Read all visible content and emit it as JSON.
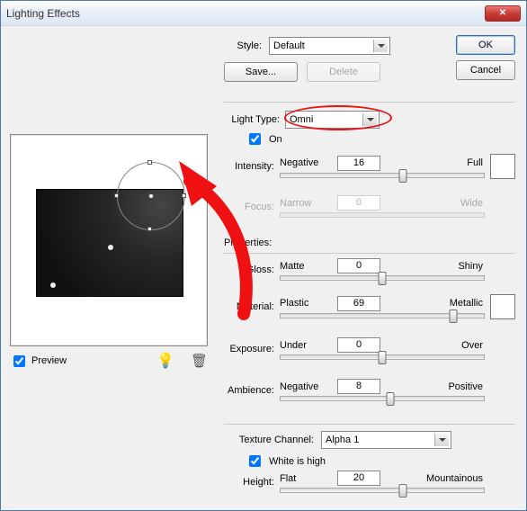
{
  "window": {
    "title": "Lighting Effects"
  },
  "buttons": {
    "ok": "OK",
    "cancel": "Cancel",
    "save": "Save...",
    "delete": "Delete"
  },
  "style": {
    "label": "Style:",
    "value": "Default"
  },
  "light_type": {
    "label": "Light Type:",
    "value": "Omni"
  },
  "on": {
    "label": "On",
    "checked": true
  },
  "sliders": {
    "intensity": {
      "label": "Intensity:",
      "left": "Negative",
      "right": "Full",
      "value": "16",
      "percent": 60
    },
    "focus": {
      "label": "Focus:",
      "left": "Narrow",
      "right": "Wide",
      "value": "0",
      "percent": 50
    },
    "gloss": {
      "label": "Gloss:",
      "left": "Matte",
      "right": "Shiny",
      "value": "0",
      "percent": 50
    },
    "material": {
      "label": "Material:",
      "left": "Plastic",
      "right": "Metallic",
      "value": "69",
      "percent": 85
    },
    "exposure": {
      "label": "Exposure:",
      "left": "Under",
      "right": "Over",
      "value": "0",
      "percent": 50
    },
    "ambience": {
      "label": "Ambience:",
      "left": "Negative",
      "right": "Positive",
      "value": "8",
      "percent": 54
    },
    "height": {
      "label": "Height:",
      "left": "Flat",
      "right": "Mountainous",
      "value": "20",
      "percent": 60
    }
  },
  "properties_label": "Properties:",
  "texture": {
    "label": "Texture Channel:",
    "value": "Alpha 1"
  },
  "white_is_high": {
    "label": "White is high",
    "checked": true
  },
  "preview": {
    "label": "Preview",
    "checked": true
  }
}
